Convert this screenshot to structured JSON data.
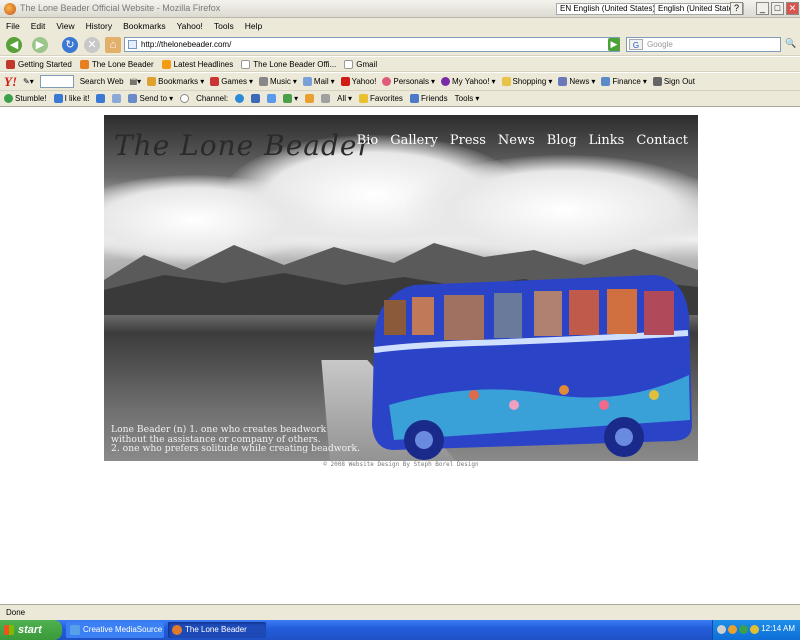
{
  "window": {
    "title": "The Lone Beader Official Website - Mozilla Firefox",
    "lang_input": "EN English (United States)",
    "lang_input2": "English (United States)",
    "help_btn": "?",
    "min_btn": "_",
    "max_btn": "□",
    "close_btn": "✕"
  },
  "menu": [
    "File",
    "Edit",
    "View",
    "History",
    "Bookmarks",
    "Yahoo!",
    "Tools",
    "Help"
  ],
  "nav": {
    "url": "http://thelonebeader.com/",
    "search_placeholder": "Google",
    "search_engine_icon": "G"
  },
  "bookmarks": [
    {
      "label": "Getting Started",
      "color": "#c0392b"
    },
    {
      "label": "The Lone Beader",
      "color": "#e67e22"
    },
    {
      "label": "Latest Headlines",
      "color": "#f39c12"
    },
    {
      "label": "The Lone Beader Offi...",
      "color": "#d0d0d0"
    },
    {
      "label": "Gmail",
      "color": "#ffffff"
    }
  ],
  "yahoo_toolbar": {
    "logo": "Y!",
    "items": [
      "Search Web",
      "Bookmarks",
      "Games",
      "Music",
      "Mail",
      "Yahoo!",
      "Personals",
      "My Yahoo!",
      "Shopping",
      "News",
      "Finance",
      "Sign Out"
    ]
  },
  "stumble_toolbar": {
    "items": [
      "Stumble!",
      "I like it!",
      "Send to",
      "Channel:",
      "All",
      "Favorites",
      "Friends",
      "Tools"
    ]
  },
  "page": {
    "logo": "The Lone Beader",
    "nav_links": [
      "Bio",
      "Gallery",
      "Press",
      "News",
      "Blog",
      "Links",
      "Contact"
    ],
    "tagline_lines": [
      "Lone Beader (n) 1. one who creates beadwork",
      "without the assistance or company of others.",
      "2. one who prefers solitude while creating beadwork."
    ],
    "copyright": "© 2008 Website Design By Steph Borel Design"
  },
  "status": "Done",
  "taskbar": {
    "start": "start",
    "tasks": [
      {
        "label": "Creative MediaSource",
        "color": "#5aa0e8"
      },
      {
        "label": "The Lone Beader Offi...",
        "color": "#e07a2a"
      }
    ],
    "clock": "12:14 AM"
  },
  "colors": {
    "chrome_bg": "#ece9d8",
    "taskbar_blue": "#245edb",
    "start_green": "#3a9a3a",
    "bus_blue": "#2b43c7"
  }
}
